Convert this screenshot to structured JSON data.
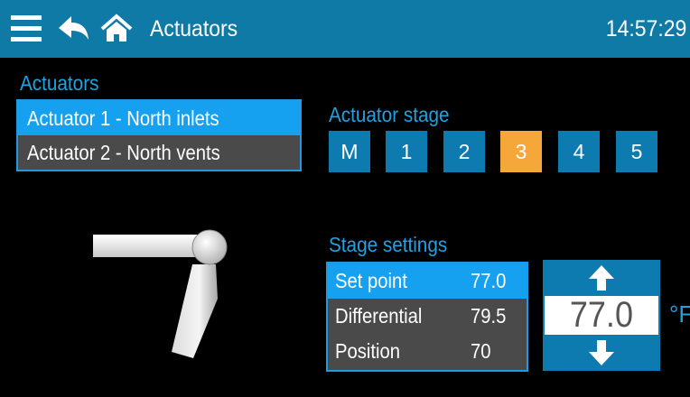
{
  "header": {
    "title": "Actuators",
    "time": "14:57:29",
    "icons": [
      "menu-icon",
      "back-icon",
      "home-icon"
    ],
    "color": "#0f7aa6"
  },
  "actuators": {
    "label": "Actuators",
    "items": [
      {
        "label": "Actuator 1 - North inlets",
        "selected": true
      },
      {
        "label": "Actuator 2 - North vents",
        "selected": false
      }
    ]
  },
  "stage": {
    "label": "Actuator stage",
    "buttons": [
      "M",
      "1",
      "2",
      "3",
      "4",
      "5"
    ],
    "active": "3",
    "active_color": "#f6a73a",
    "button_color": "#0d7ab0"
  },
  "settings": {
    "label": "Stage settings",
    "rows": [
      {
        "label": "Set point",
        "value": "77.0",
        "selected": true
      },
      {
        "label": "Differential",
        "value": "79.5",
        "selected": false
      },
      {
        "label": "Position",
        "value": "70",
        "selected": false
      }
    ],
    "highlight_color": "#15a1ef"
  },
  "spinner": {
    "value": "77.0",
    "unit": "°F",
    "up_icon": "arrow-up-icon",
    "down_icon": "arrow-down-icon"
  }
}
